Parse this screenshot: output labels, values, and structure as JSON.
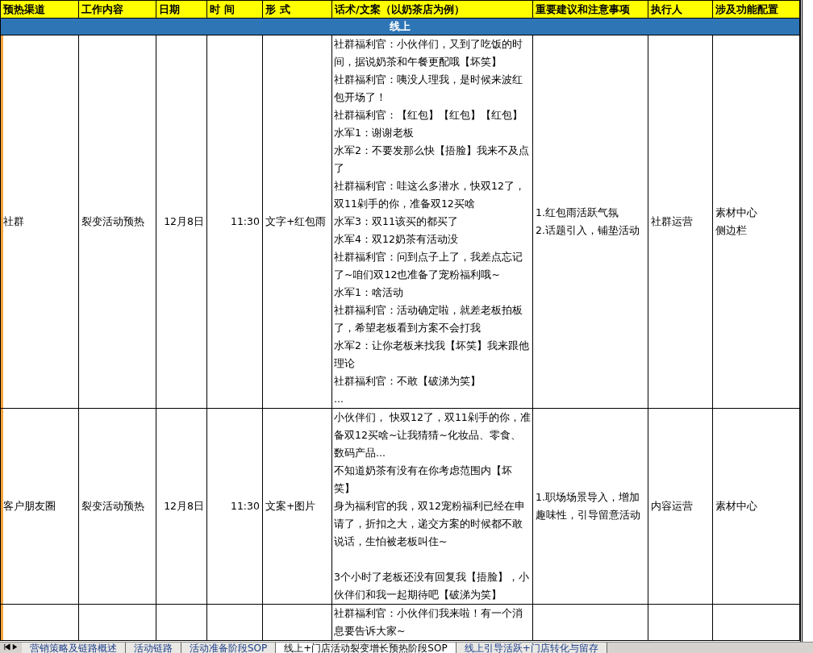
{
  "header": [
    "预热渠道",
    "工作内容",
    "日期",
    "时 间",
    "形  式",
    "话术/文案（以奶茶店为例）",
    "重要建议和注意事项",
    "执行人",
    "涉及功能配置"
  ],
  "section": "线上",
  "rows": [
    {
      "channel": "社群",
      "task": "裂变活动预热",
      "date": "12月8日",
      "time": "11:30",
      "format": "文字+红包雨",
      "script": [
        [
          "社群福利官：小伙伴们，又到了吃饭的时间，据说奶茶和午餐更配哦【坏笑】",
          "社群福利官：咦没人理我，是时候来波红包开场了！",
          "社群福利官：【红包】【红包】【红包】",
          "水军1：谢谢老板",
          "水军2：不要发那么快【捂脸】我来不及点了",
          "社群福利官：哇这么多潜水，快双12了，双11剁手的你，准备双12买啥",
          "水军3：双11该买的都买了",
          "水军4：双12奶茶有活动没",
          "社群福利官：问到点子上了，我差点忘记了~咱们双12也准备了宠粉福利哦~",
          "水军1：啥活动",
          "社群福利官：活动确定啦，就差老板拍板了，希望老板看到方案不会打我",
          "水军2：让你老板来找我【坏笑】我来跟他理论",
          "社群福利官：不敢【破涕为笑】",
          "..."
        ]
      ],
      "notes": [
        "1.红包雨活跃气氛",
        "2.话题引入，铺垫活动"
      ],
      "owner": "社群运营",
      "features": [
        "素材中心",
        "侧边栏"
      ]
    },
    {
      "channel": "客户朋友圈",
      "task": "裂变活动预热",
      "date": "12月8日",
      "time": "11:30",
      "format": "文案+图片",
      "script": [
        [
          "小伙伴们， 快双12了，双11剁手的你，准备双12买啥~让我猜猜~化妆品、零食、数码产品...",
          "不知道奶茶有没有在你考虑范围内【坏笑】",
          "身为福利官的我，双12宠粉福利已经在申请了，折扣之大，递交方案的时候都不敢说话，生怕被老板叫住~"
        ],
        [
          "3个小时了老板还没有回复我【捂脸】，小伙伴们和我一起期待吧【破涕为笑】"
        ]
      ],
      "notes": [
        "1.职场场景导入，增加趣味性，引导留意活动"
      ],
      "owner": "内容运营",
      "features": [
        "素材中心"
      ]
    },
    {
      "script": [
        [
          "社群福利官：小伙伴们我来啦！有一个消息要告诉大家~"
        ]
      ]
    }
  ],
  "sheet_tabs": [
    {
      "label": "营销策略及链路概述",
      "selected": false
    },
    {
      "label": "活动链路",
      "selected": false
    },
    {
      "label": "活动准备阶段SOP",
      "selected": false
    },
    {
      "label": "线上+门店活动裂变增长预热阶段SOP",
      "selected": true
    },
    {
      "label": "线上引导活跃+门店转化与留存",
      "selected": false
    }
  ]
}
